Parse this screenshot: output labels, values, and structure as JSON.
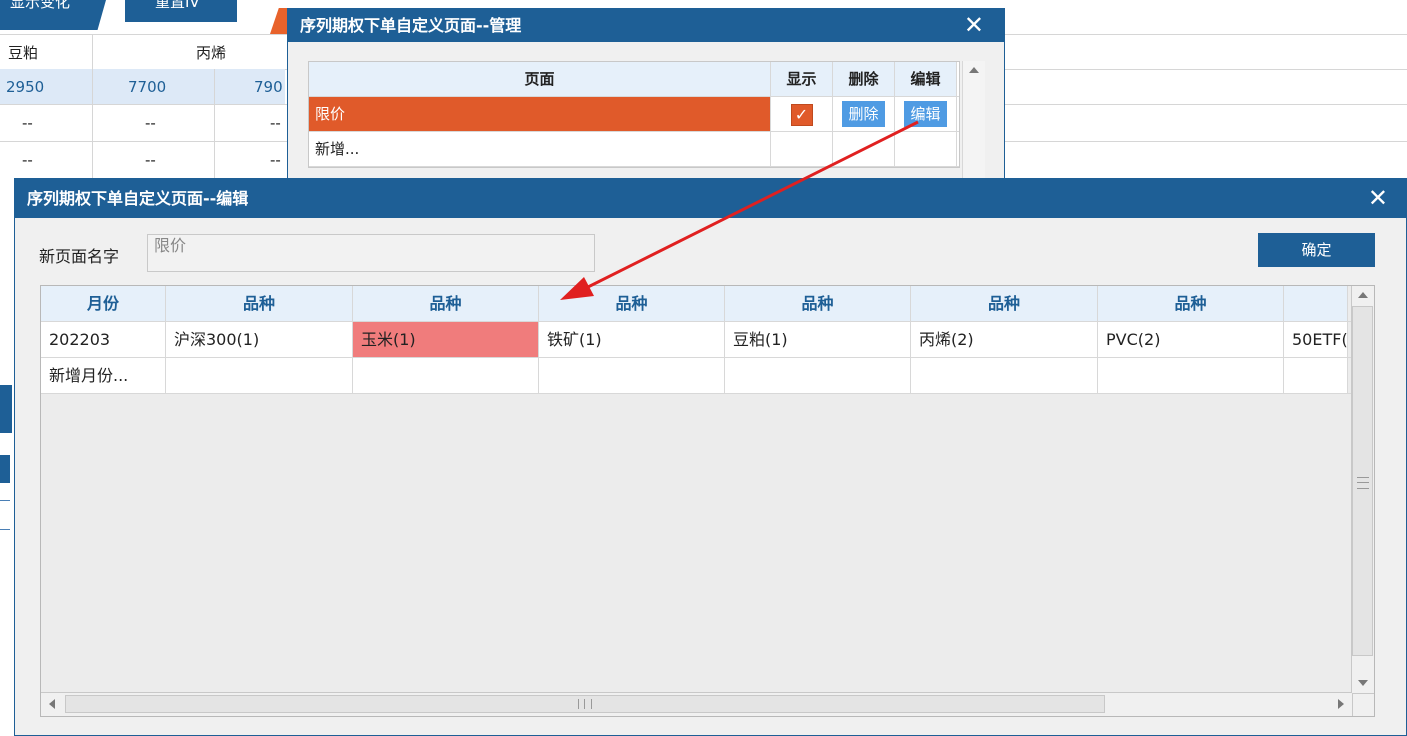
{
  "background": {
    "tabs": [
      "显示变化",
      "重置IV"
    ],
    "header": [
      "豆粕",
      "丙烯"
    ],
    "row1": [
      "2950",
      "7700",
      "790"
    ],
    "row2": [
      "--",
      "--",
      "--"
    ],
    "row3": [
      "--",
      "--",
      "--"
    ]
  },
  "manage_dialog": {
    "title": "序列期权下单自定义页面--管理",
    "columns": [
      "页面",
      "显示",
      "删除",
      "编辑"
    ],
    "rows": [
      {
        "page": "限价",
        "shown": true,
        "delete_label": "删除",
        "edit_label": "编辑"
      },
      {
        "page": "新增..."
      }
    ]
  },
  "edit_dialog": {
    "title": "序列期权下单自定义页面--编辑",
    "name_label": "新页面名字",
    "name_value": "限价",
    "confirm_label": "确定",
    "grid": {
      "headers": [
        "月份",
        "品种",
        "品种",
        "品种",
        "品种",
        "品种",
        "品种",
        ""
      ],
      "rows": [
        [
          "202203",
          "沪深300(1)",
          "玉米(1)",
          "铁矿(1)",
          "豆粕(1)",
          "丙烯(2)",
          "PVC(2)",
          "50ETF("
        ],
        [
          "新增月份...",
          "",
          "",
          "",
          "",
          "",
          "",
          ""
        ]
      ]
    }
  },
  "colors": {
    "title_bar": "#1e5f96",
    "selected_row": "#e05a2a",
    "highlight_cell": "#f07c7c",
    "button_blue": "#4f9be3",
    "arrow": "#e02020"
  }
}
